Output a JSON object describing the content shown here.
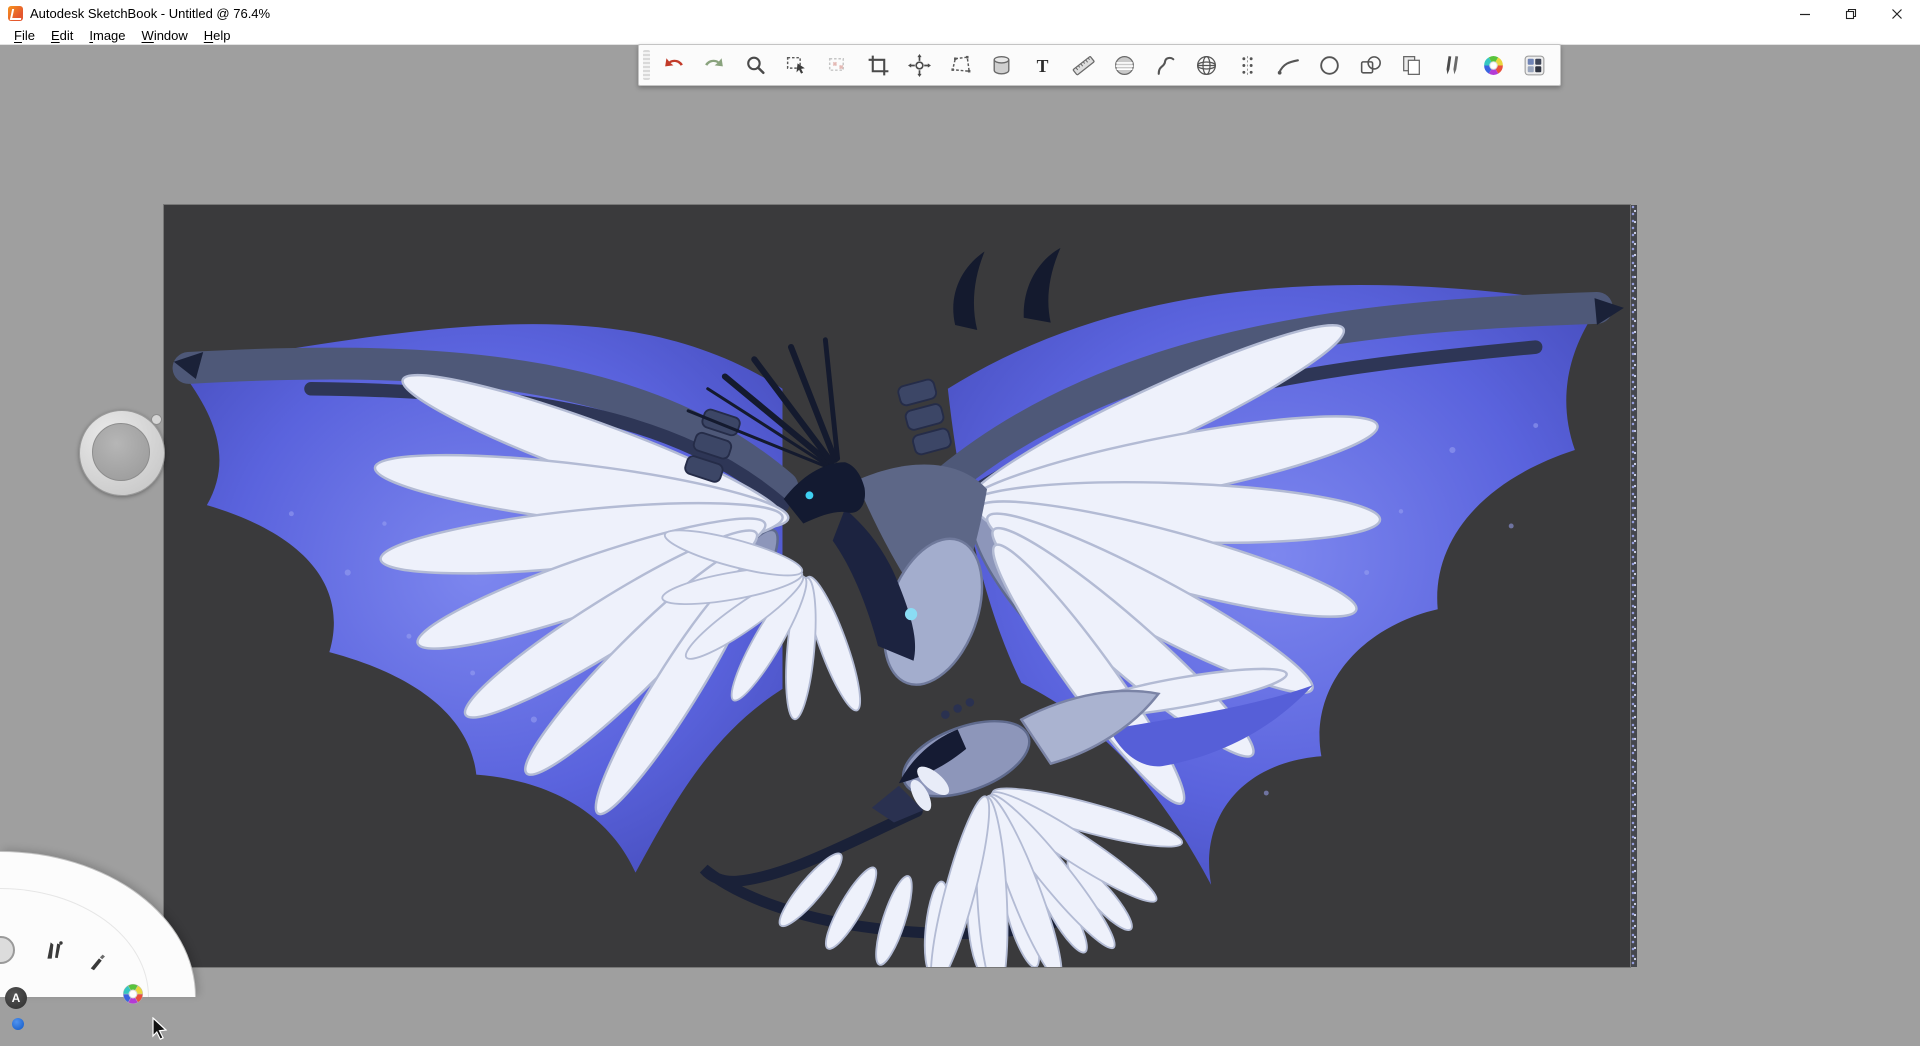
{
  "window": {
    "app": "Autodesk SketchBook",
    "title": "Autodesk SketchBook - Untitled @ 76.4%",
    "document": "Untitled",
    "zoom": "76.4%",
    "controls": {
      "minimize": "Minimize",
      "restore": "Restore Down",
      "close": "Close"
    }
  },
  "menu": {
    "items": [
      "File",
      "Edit",
      "Image",
      "Window",
      "Help"
    ]
  },
  "toolbar": {
    "tools": [
      "Undo",
      "Redo",
      "Zoom",
      "Selection",
      "Quick Selection",
      "Crop",
      "Transform",
      "Distort",
      "Fill",
      "Add Text",
      "Ruler",
      "Ellipse Guide",
      "French Curve",
      "Perspective",
      "Symmetry",
      "Steady Stroke",
      "Ellipse",
      "Shapes",
      "Import Image",
      "Brush Library",
      "Color Editor",
      "Layer Editor"
    ]
  },
  "corner_lagoon": {
    "tools": [
      "Brush Palette",
      "Brush Puck",
      "Color Wheel"
    ],
    "logo_letter": "A"
  },
  "canvas": {
    "artwork": "blue-white dragon illustration, wings spread, on dark canvas"
  },
  "colors": {
    "workspace": "#9f9f9f",
    "canvas": "#3a3a3c",
    "membrane_blue": "#5a63dd",
    "blade_white": "#eef1fb",
    "covert_gray": "#8d96ba",
    "slate_dark": "#4e5878",
    "navy": "#161c33",
    "undo_red": "#c23b2a",
    "redo_green": "#8aa37e"
  }
}
